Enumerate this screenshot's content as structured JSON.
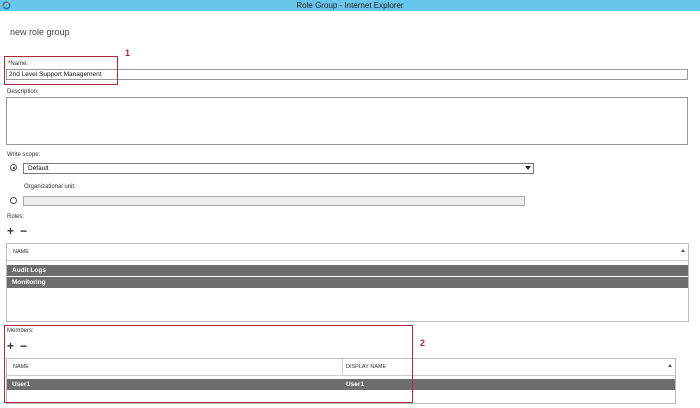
{
  "window": {
    "title": "Role Group - Internet Explorer",
    "icon": "internet-explorer-icon"
  },
  "page": {
    "heading": "new role group"
  },
  "form": {
    "name_label": "*Name:",
    "name_value": "2nd Level Support Management",
    "description_label": "Description:",
    "description_value": "",
    "write_scope_label": "Write scope:",
    "write_scope_value": "Default",
    "org_unit_label": "Organizational unit:",
    "org_unit_value": ""
  },
  "roles": {
    "label": "Roles:",
    "add_icon": "+",
    "remove_icon": "−",
    "column": "NAME",
    "items": [
      "Audit Logs",
      "Monitoring"
    ]
  },
  "members": {
    "label": "Members:",
    "add_icon": "+",
    "remove_icon": "−",
    "columns": [
      "NAME",
      "DISPLAY NAME"
    ],
    "rows": [
      {
        "name": "User1",
        "display_name": "User1"
      }
    ]
  },
  "callouts": [
    "1",
    "2"
  ],
  "colors": {
    "titlebar": "#67c6eb",
    "callout": "#b22a36",
    "selected_row": "#6d6d6d"
  }
}
